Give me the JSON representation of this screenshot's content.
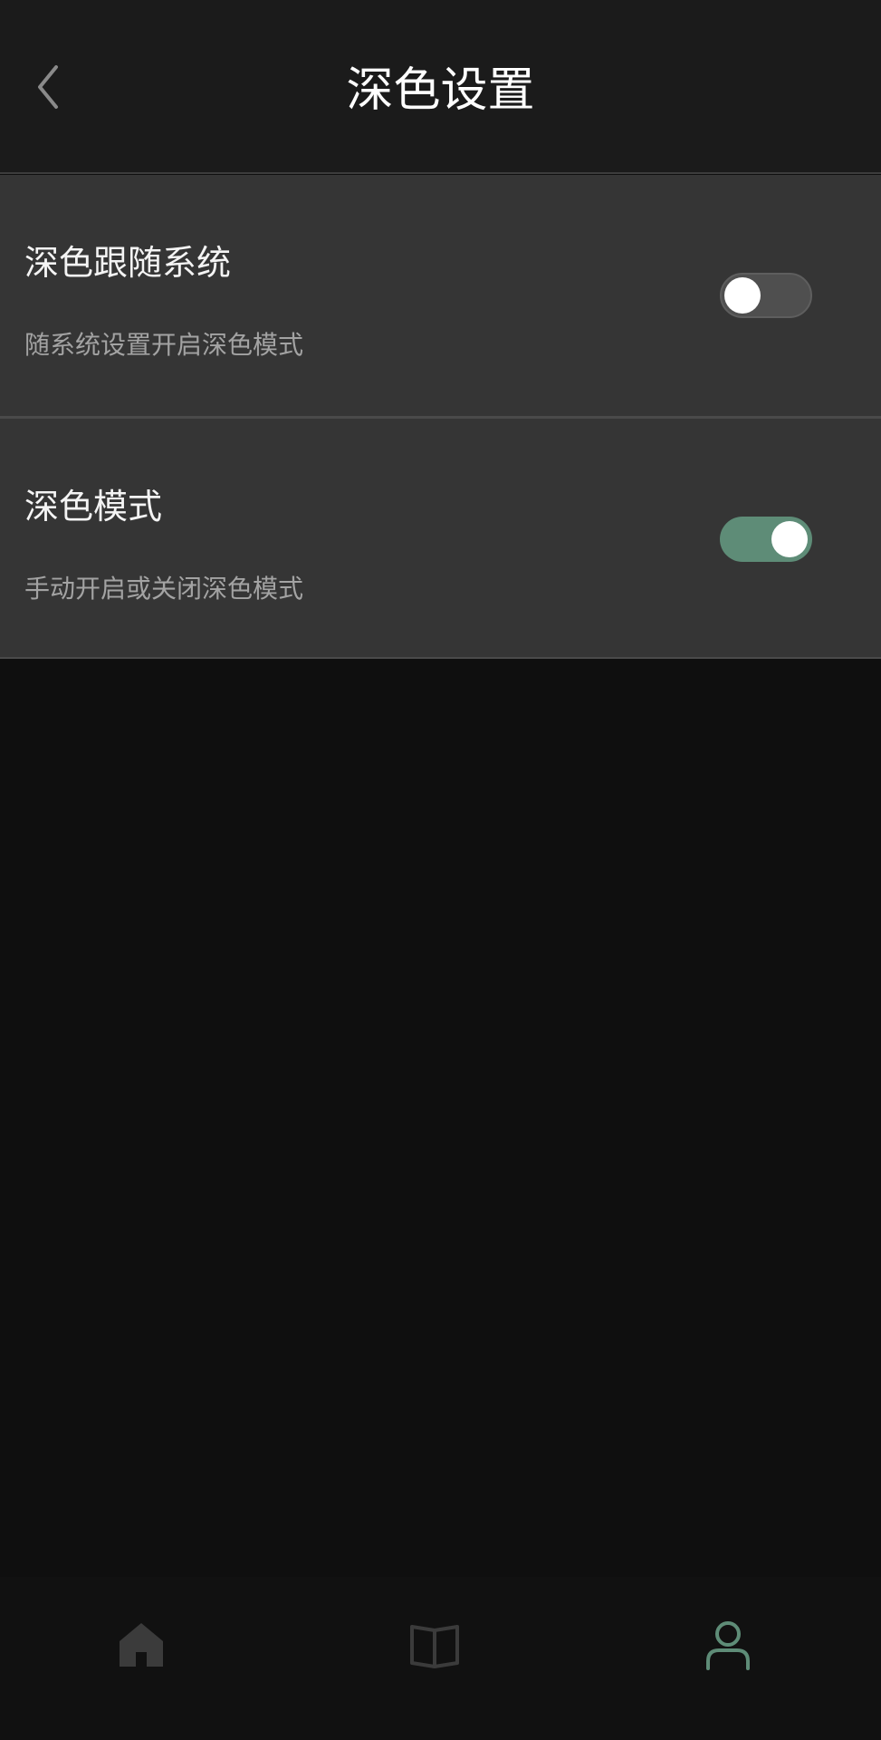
{
  "header": {
    "title": "深色设置",
    "back_icon": "chevron-left-icon"
  },
  "settings": [
    {
      "title": "深色跟随系统",
      "description": "随系统设置开启深色模式",
      "enabled": false
    },
    {
      "title": "深色模式",
      "description": "手动开启或关闭深色模式",
      "enabled": true
    }
  ],
  "tab_bar": {
    "items": [
      {
        "icon": "home-icon",
        "active": false
      },
      {
        "icon": "book-icon",
        "active": false
      },
      {
        "icon": "user-icon",
        "active": true
      }
    ]
  },
  "colors": {
    "accent": "#5e8c77",
    "background": "#0f0f0f",
    "row_background": "#353535"
  }
}
